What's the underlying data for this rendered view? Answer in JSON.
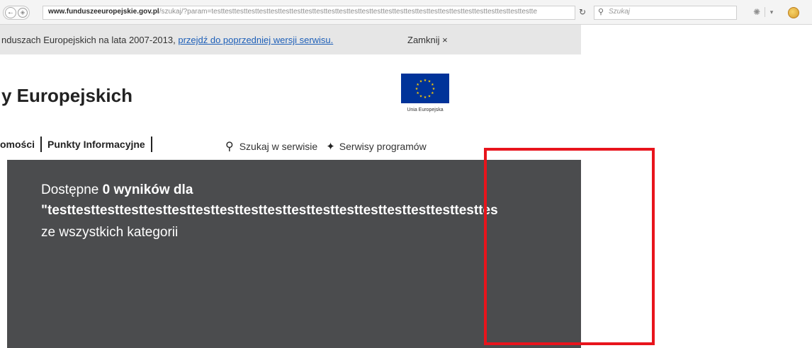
{
  "browser": {
    "url_host": "www.funduszeeuropejskie.gov.pl",
    "url_path": "/szukaj/?param=testtesttesttesttesttesttesttesttesttesttesttesttesttesttesttesttesttesttesttesttesttesttesttesttesttesttesttestte",
    "search_placeholder": "Szukaj",
    "icons": {
      "back": "back-arrow-icon",
      "site_info": "globe-icon",
      "reload": "reload-icon",
      "search": "search-icon",
      "extension": "extension-icon",
      "dropdown": "chevron-down-icon",
      "addon": "addon-icon"
    }
  },
  "banner": {
    "text": "nduszach Europejskich na lata 2007-2013, ",
    "link": "przejdź do poprzedniej wersji serwisu.",
    "close": "Zamknij ×"
  },
  "header": {
    "title": "y Europejskich",
    "eu_label": "Unia Europejska"
  },
  "nav": {
    "items": [
      "omości",
      "Punkty Informacyjne"
    ],
    "search": "Szukaj w serwisie",
    "programs": "Serwisy programów"
  },
  "results": {
    "prefix": "Dostępne ",
    "count": "0 wyników dla",
    "query": "\"testtesttesttesttesttesttesttesttesttesttesttesttesttesttesttesttesttesttes",
    "scope": "ze wszystkich kategorii"
  },
  "colors": {
    "results_bg": "#4b4c4e",
    "highlight": "#e8141c",
    "eu_blue": "#003399",
    "eu_star": "#ffcc00",
    "link": "#1d5fb8"
  }
}
